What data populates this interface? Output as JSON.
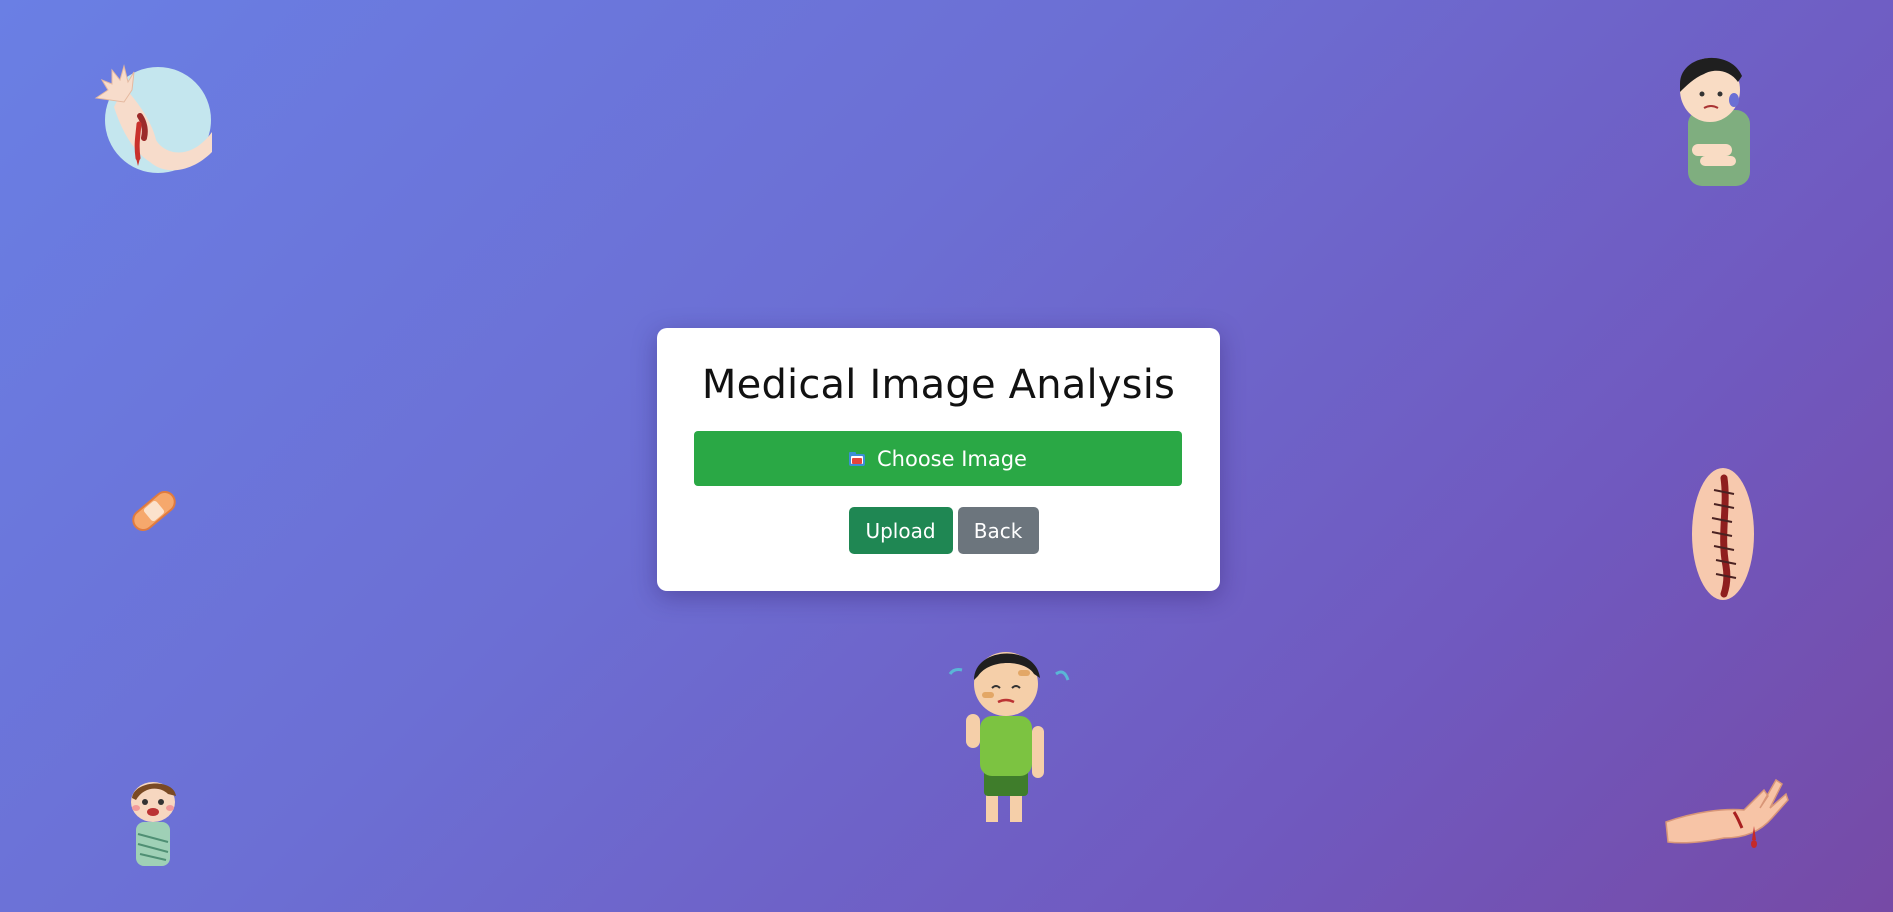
{
  "page": {
    "title": "Medical Image Analysis"
  },
  "upload_form": {
    "choose_label": "Choose Image",
    "choose_icon": "folder-icon",
    "upload_label": "Upload",
    "back_label": "Back"
  },
  "decorations": [
    {
      "name": "bleeding-arm-illustration"
    },
    {
      "name": "holding-arm-person-illustration"
    },
    {
      "name": "bandage-illustration"
    },
    {
      "name": "stitched-wound-illustration"
    },
    {
      "name": "bruised-crying-boy-illustration"
    },
    {
      "name": "injured-man-illustration"
    },
    {
      "name": "cut-hand-illustration"
    }
  ],
  "colors": {
    "background_start": "#6a7fe4",
    "background_end": "#764aa6",
    "choose_button": "#2aa845",
    "upload_button": "#1f8753",
    "back_button": "#6c757d"
  }
}
